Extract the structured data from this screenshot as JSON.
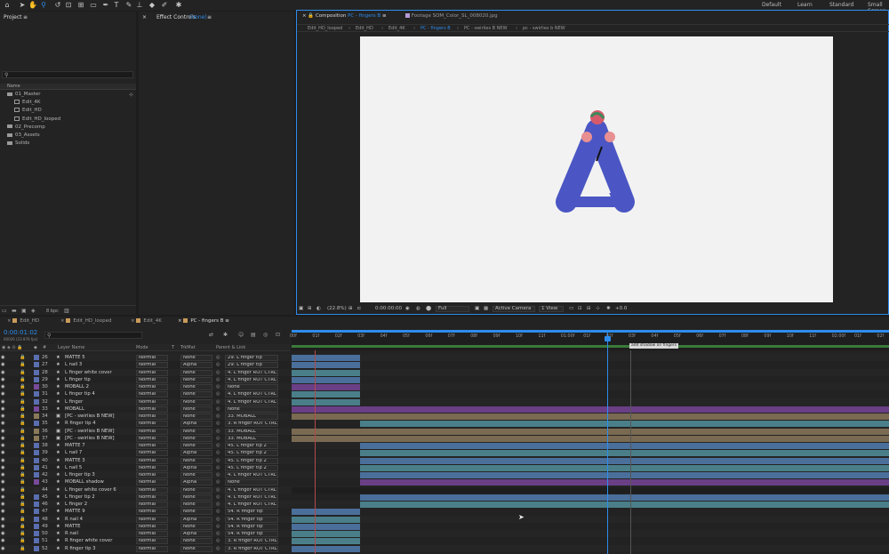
{
  "workspaces": [
    "Default",
    "Learn",
    "Standard",
    "Small Screen"
  ],
  "project": {
    "title": "Project",
    "col_name": "Name",
    "items": [
      {
        "name": "01_Master",
        "type": "folder",
        "indent": 0
      },
      {
        "name": "Edit_4K",
        "type": "comp",
        "indent": 1
      },
      {
        "name": "Edit_HD",
        "type": "comp",
        "indent": 1
      },
      {
        "name": "Edit_HD_looped",
        "type": "comp",
        "indent": 1
      },
      {
        "name": "02_Precomp",
        "type": "folder",
        "indent": 0
      },
      {
        "name": "03_Assets",
        "type": "folder",
        "indent": 0
      },
      {
        "name": "Solids",
        "type": "folder",
        "indent": 0
      }
    ],
    "bpc": "8 bpc"
  },
  "effect_controls": {
    "label": "Effect Controls",
    "value": "(none)"
  },
  "composition": {
    "tab_comp_prefix": "Composition",
    "tab_comp_name": "PC - fingers B",
    "tab_footage_prefix": "Footage",
    "tab_footage_name": "SOM_Color_SL_008020.jpg",
    "breadcrumbs": [
      "Edit_HD_looped",
      "Edit_HD",
      "Edit_4K",
      "PC - fingers B",
      "PC - swirlies B NEW",
      "pc - swirlies b NEW"
    ],
    "breadcrumb_selected": 3,
    "zoom": "(22.8%)",
    "timecode": "0:00:00:00",
    "resolution": "Full",
    "camera": "Active Camera",
    "views": "1 View",
    "exposure": "+0.0",
    "bg_color": "#f2f2f2",
    "shape_color": "#4b56c4"
  },
  "timeline": {
    "tabs": [
      "Edit_HD",
      "Edit_HD_looped",
      "Edit_4K",
      "PC - fingers B"
    ],
    "active_tab": 3,
    "current_time": "0:00:01:02",
    "fps_info": "00026 (23.976 fps)",
    "search_placeholder": "",
    "headers": {
      "layer_name": "Layer Name",
      "mode": "Mode",
      "t": "T",
      "trkmat": "TrkMat",
      "parent": "Parent & Link"
    },
    "ruler": [
      "00f",
      "01f",
      "02f",
      "03f",
      "04f",
      "05f",
      "06f",
      "07f",
      "08f",
      "09f",
      "10f",
      "11f",
      "01:00f",
      "01f",
      "02f",
      "03f",
      "04f",
      "05f",
      "06f",
      "07f",
      "08f",
      "09f",
      "10f",
      "11f",
      "02:00f",
      "01f",
      "02f"
    ],
    "marker_label": "add shadow on fingers",
    "layers": [
      {
        "num": "26",
        "name": "MATTE 5",
        "type": "star",
        "mode": "Normal",
        "trk": "None",
        "parent": "29. L finger tip",
        "color": "#5a6fb0",
        "bar": [
          0,
          1
        ],
        "barcolor": "#4a6f9a"
      },
      {
        "num": "27",
        "name": "L nail 3",
        "type": "star",
        "mode": "Normal",
        "trk": "Alpha",
        "parent": "29. L finger tip",
        "color": "#5a6fb0",
        "bar": [
          0,
          1
        ],
        "barcolor": "#4a6f9a"
      },
      {
        "num": "28",
        "name": "L finger white cover",
        "type": "star",
        "mode": "Normal",
        "trk": "None",
        "parent": "4. L finger ROT CTRL",
        "color": "#5a6fb0",
        "bar": [
          0,
          1
        ],
        "barcolor": "#4a7f8a"
      },
      {
        "num": "29",
        "name": "L finger tip",
        "type": "star",
        "mode": "Normal",
        "trk": "None",
        "parent": "4. L finger ROT CTRL",
        "color": "#5a6fb0",
        "bar": [
          0,
          1
        ],
        "barcolor": "#4a6f9a"
      },
      {
        "num": "30",
        "name": "MOBALL 2",
        "type": "star",
        "mode": "Normal",
        "trk": "None",
        "parent": "None",
        "color": "#7a4a9a",
        "bar": [
          0,
          1
        ],
        "barcolor": "#6a3f86"
      },
      {
        "num": "31",
        "name": "L finger tip 4",
        "type": "star",
        "mode": "Normal",
        "trk": "None",
        "parent": "4. L finger ROT CTRL",
        "color": "#5a6fb0",
        "bar": [
          0,
          1
        ],
        "barcolor": "#4a7f8a"
      },
      {
        "num": "32",
        "name": "L finger",
        "type": "star",
        "mode": "Normal",
        "trk": "None",
        "parent": "4. L finger ROT CTRL",
        "color": "#5a6fb0",
        "bar": [
          0,
          1
        ],
        "barcolor": "#4a7f8a"
      },
      {
        "num": "33",
        "name": "MOBALL",
        "type": "star",
        "mode": "Normal",
        "trk": "None",
        "parent": "None",
        "color": "#7a4a9a",
        "bar": [
          0,
          4
        ],
        "barcolor": "#6a3f86"
      },
      {
        "num": "34",
        "name": "[PC - swirlies B NEW]",
        "type": "comp",
        "mode": "Normal",
        "trk": "None",
        "parent": "33. MOBALL",
        "color": "#8a7a5a",
        "bar": [
          0,
          4
        ],
        "barcolor": "#7a6a52"
      },
      {
        "num": "35",
        "name": "R finger tip 4",
        "type": "star",
        "mode": "Normal",
        "trk": "Alpha",
        "parent": "3. R finger ROT CTRL",
        "color": "#5a6fb0",
        "bar": [
          1,
          4
        ],
        "barcolor": "#4a7f8a"
      },
      {
        "num": "36",
        "name": "[PC - swirlies B NEW]",
        "type": "comp",
        "mode": "Normal",
        "trk": "None",
        "parent": "33. MOBALL",
        "color": "#8a7a5a",
        "bar": [
          0,
          4
        ],
        "barcolor": "#7a6a52"
      },
      {
        "num": "37",
        "name": "[PC - swirlies B NEW]",
        "type": "comp",
        "mode": "Normal",
        "trk": "None",
        "parent": "33. MOBALL",
        "color": "#8a7a5a",
        "bar": [
          0,
          4
        ],
        "barcolor": "#7a6a52"
      },
      {
        "num": "38",
        "name": "MATTE 7",
        "type": "star",
        "mode": "Normal",
        "trk": "None",
        "parent": "45. L finger tip 2",
        "color": "#5a6fb0",
        "bar": [
          1,
          4
        ],
        "barcolor": "#4a6f9a"
      },
      {
        "num": "39",
        "name": "L nail 7",
        "type": "star",
        "mode": "Normal",
        "trk": "Alpha",
        "parent": "45. L finger tip 2",
        "color": "#5a6fb0",
        "bar": [
          1,
          4
        ],
        "barcolor": "#4a7f8a"
      },
      {
        "num": "40",
        "name": "MATTE 3",
        "type": "star",
        "mode": "Normal",
        "trk": "None",
        "parent": "45. L finger tip 2",
        "color": "#5a6fb0",
        "bar": [
          1,
          4
        ],
        "barcolor": "#4a6f9a"
      },
      {
        "num": "41",
        "name": "L nail 5",
        "type": "star",
        "mode": "Normal",
        "trk": "Alpha",
        "parent": "45. L finger tip 2",
        "color": "#5a6fb0",
        "bar": [
          1,
          4
        ],
        "barcolor": "#4a7f8a"
      },
      {
        "num": "42",
        "name": "L finger tip 3",
        "type": "star",
        "mode": "Normal",
        "trk": "None",
        "parent": "4. L finger ROT CTRL",
        "color": "#5a6fb0",
        "bar": [
          1,
          4
        ],
        "barcolor": "#4a6f9a"
      },
      {
        "num": "43",
        "name": "MOBALL shadow",
        "type": "star",
        "mode": "Normal",
        "trk": "Alpha",
        "parent": "None",
        "color": "#7a4a9a",
        "bar": [
          1,
          4
        ],
        "barcolor": "#6a3f86"
      },
      {
        "num": "44",
        "name": "L finger white cover 6",
        "type": "star",
        "mode": "Normal",
        "trk": "None",
        "parent": "4. L finger ROT CTRL",
        "color": "#2a2a2a",
        "bar": [
          0,
          4
        ],
        "barcolor": "#1e1e1e"
      },
      {
        "num": "45",
        "name": "L finger tip 2",
        "type": "star",
        "mode": "Normal",
        "trk": "None",
        "parent": "4. L finger ROT CTRL",
        "color": "#5a6fb0",
        "bar": [
          1,
          4
        ],
        "barcolor": "#4a6f9a"
      },
      {
        "num": "46",
        "name": "L finger 2",
        "type": "star",
        "mode": "Normal",
        "trk": "None",
        "parent": "4. L finger ROT CTRL",
        "color": "#5a6fb0",
        "bar": [
          1,
          4
        ],
        "barcolor": "#4a7f8a"
      },
      {
        "num": "47",
        "name": "MATTE 9",
        "type": "star",
        "mode": "Normal",
        "trk": "None",
        "parent": "54. R finger tip",
        "color": "#5a6fb0",
        "bar": [
          0,
          1
        ],
        "barcolor": "#4a6f9a"
      },
      {
        "num": "48",
        "name": "R nail 4",
        "type": "star",
        "mode": "Normal",
        "trk": "Alpha",
        "parent": "54. R finger tip",
        "color": "#5a6fb0",
        "bar": [
          0,
          1
        ],
        "barcolor": "#4a7f8a"
      },
      {
        "num": "49",
        "name": "MATTE",
        "type": "star",
        "mode": "Normal",
        "trk": "None",
        "parent": "54. R finger tip",
        "color": "#5a6fb0",
        "bar": [
          0,
          1
        ],
        "barcolor": "#4a6f9a"
      },
      {
        "num": "50",
        "name": "R nail",
        "type": "star",
        "mode": "Normal",
        "trk": "Alpha",
        "parent": "54. R finger tip",
        "color": "#5a6fb0",
        "bar": [
          0,
          1
        ],
        "barcolor": "#4a7f8a"
      },
      {
        "num": "51",
        "name": "R finger white cover",
        "type": "star",
        "mode": "Normal",
        "trk": "None",
        "parent": "3. R finger ROT CTRL",
        "color": "#5a6fb0",
        "bar": [
          0,
          1
        ],
        "barcolor": "#4a7f8a"
      },
      {
        "num": "52",
        "name": "R finger tip 3",
        "type": "star",
        "mode": "Normal",
        "trk": "None",
        "parent": "3. R finger ROT CTRL",
        "color": "#5a6fb0",
        "bar": [
          0,
          1
        ],
        "barcolor": "#4a6f9a"
      }
    ]
  }
}
